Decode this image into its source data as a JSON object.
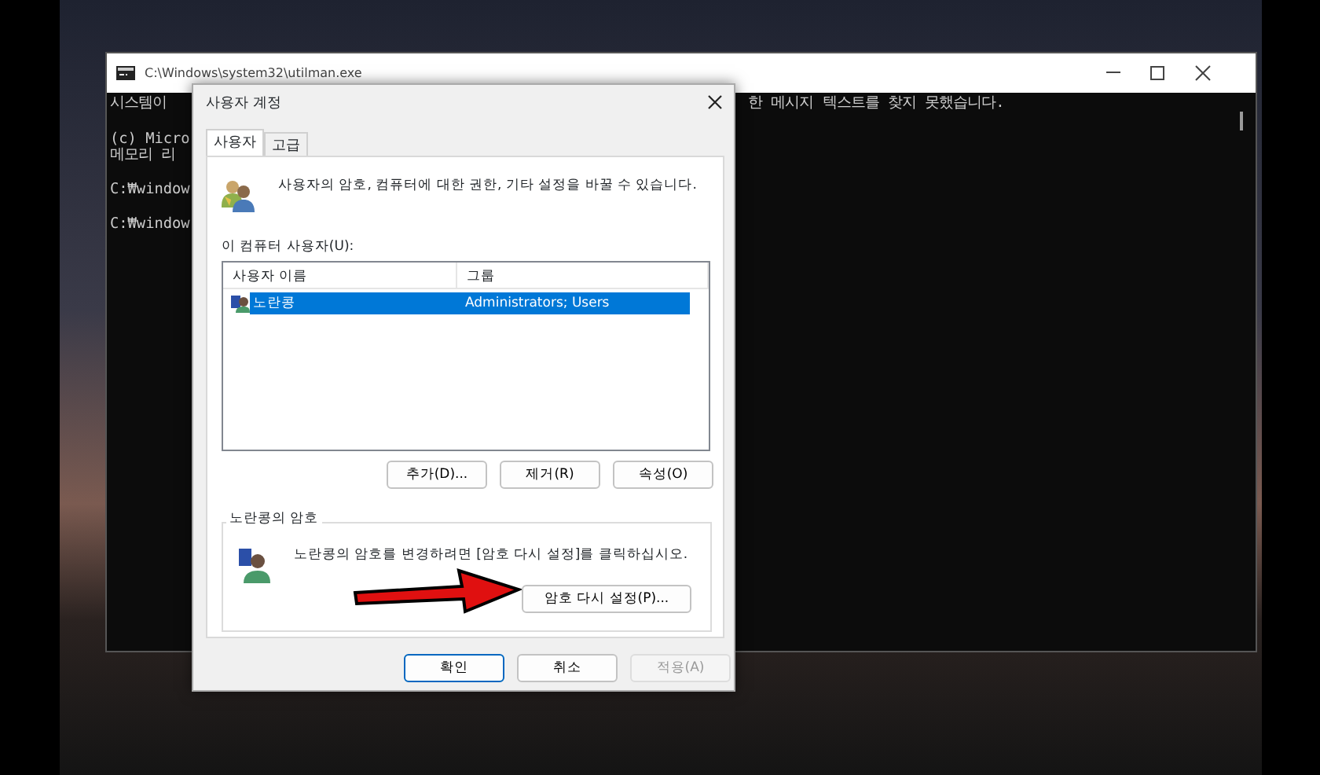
{
  "console_window": {
    "title": "C:\\Windows\\system32\\utilman.exe",
    "paragraphs": [
      [
        {
          "left": "시스템이",
          "right": "한 메시지 텍스트를 찾지 못했습니다."
        }
      ],
      [
        {
          "left": "(c) Micro"
        },
        {
          "left": "메모리 리"
        }
      ],
      [
        {
          "left": "C:₩window"
        }
      ],
      [
        {
          "left": "C:₩window"
        }
      ]
    ]
  },
  "dialog": {
    "title": "사용자 계정",
    "tabs": [
      {
        "label": "사용자",
        "selected": true
      },
      {
        "label": "고급",
        "selected": false
      }
    ],
    "description": "사용자의 암호, 컴퓨터에 대한 권한, 기타 설정을 바꿀 수 있습니다.",
    "users_label": "이 컴퓨터 사용자(U):",
    "user_list": {
      "columns": [
        "사용자 이름",
        "그룹"
      ],
      "rows": [
        {
          "name": "노란콩",
          "group": "Administrators; Users",
          "selected": true
        }
      ]
    },
    "list_buttons": [
      "추가(D)...",
      "제거(R)",
      "속성(O)"
    ],
    "password_group": {
      "title": "노란콩의 암호",
      "text": "노란콩의 암호를 변경하려면 [암호 다시 설정]를 클릭하십시오.",
      "button": "암호 다시 설정(P)..."
    },
    "footer_buttons": [
      {
        "label": "확인",
        "disabled": false,
        "default": true
      },
      {
        "label": "취소",
        "disabled": false,
        "default": false
      },
      {
        "label": "적용(A)",
        "disabled": true,
        "default": false
      }
    ]
  }
}
